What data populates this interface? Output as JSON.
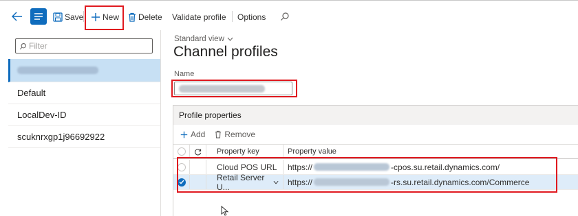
{
  "toolbar": {
    "save_label": "Save",
    "new_label": "New",
    "delete_label": "Delete",
    "validate_label": "Validate profile",
    "options_label": "Options"
  },
  "sidebar": {
    "filter_placeholder": "Filter",
    "items": [
      {
        "label": "",
        "redacted": true,
        "selected": true
      },
      {
        "label": "Default"
      },
      {
        "label": "LocalDev-ID"
      },
      {
        "label": "scuknrxgp1j96692922"
      }
    ]
  },
  "main": {
    "view_label": "Standard view",
    "title": "Channel profiles",
    "name_label": "Name",
    "name_value": ""
  },
  "profile_properties": {
    "header": "Profile properties",
    "add_label": "Add",
    "remove_label": "Remove",
    "columns": {
      "key": "Property key",
      "value": "Property value"
    },
    "rows": [
      {
        "key": "Cloud POS URL",
        "value_prefix": "https://",
        "value_suffix": "-cpos.su.retail.dynamics.com/",
        "selected": false
      },
      {
        "key": "Retail Server U...",
        "value_prefix": "https://",
        "value_suffix": "-rs.su.retail.dynamics.com/Commerce",
        "selected": true
      }
    ]
  },
  "colors": {
    "accent": "#0f6cbd",
    "highlight_box": "#e0191f",
    "selected_row": "#deecf9",
    "selected_list_item": "#c7e0f4"
  }
}
